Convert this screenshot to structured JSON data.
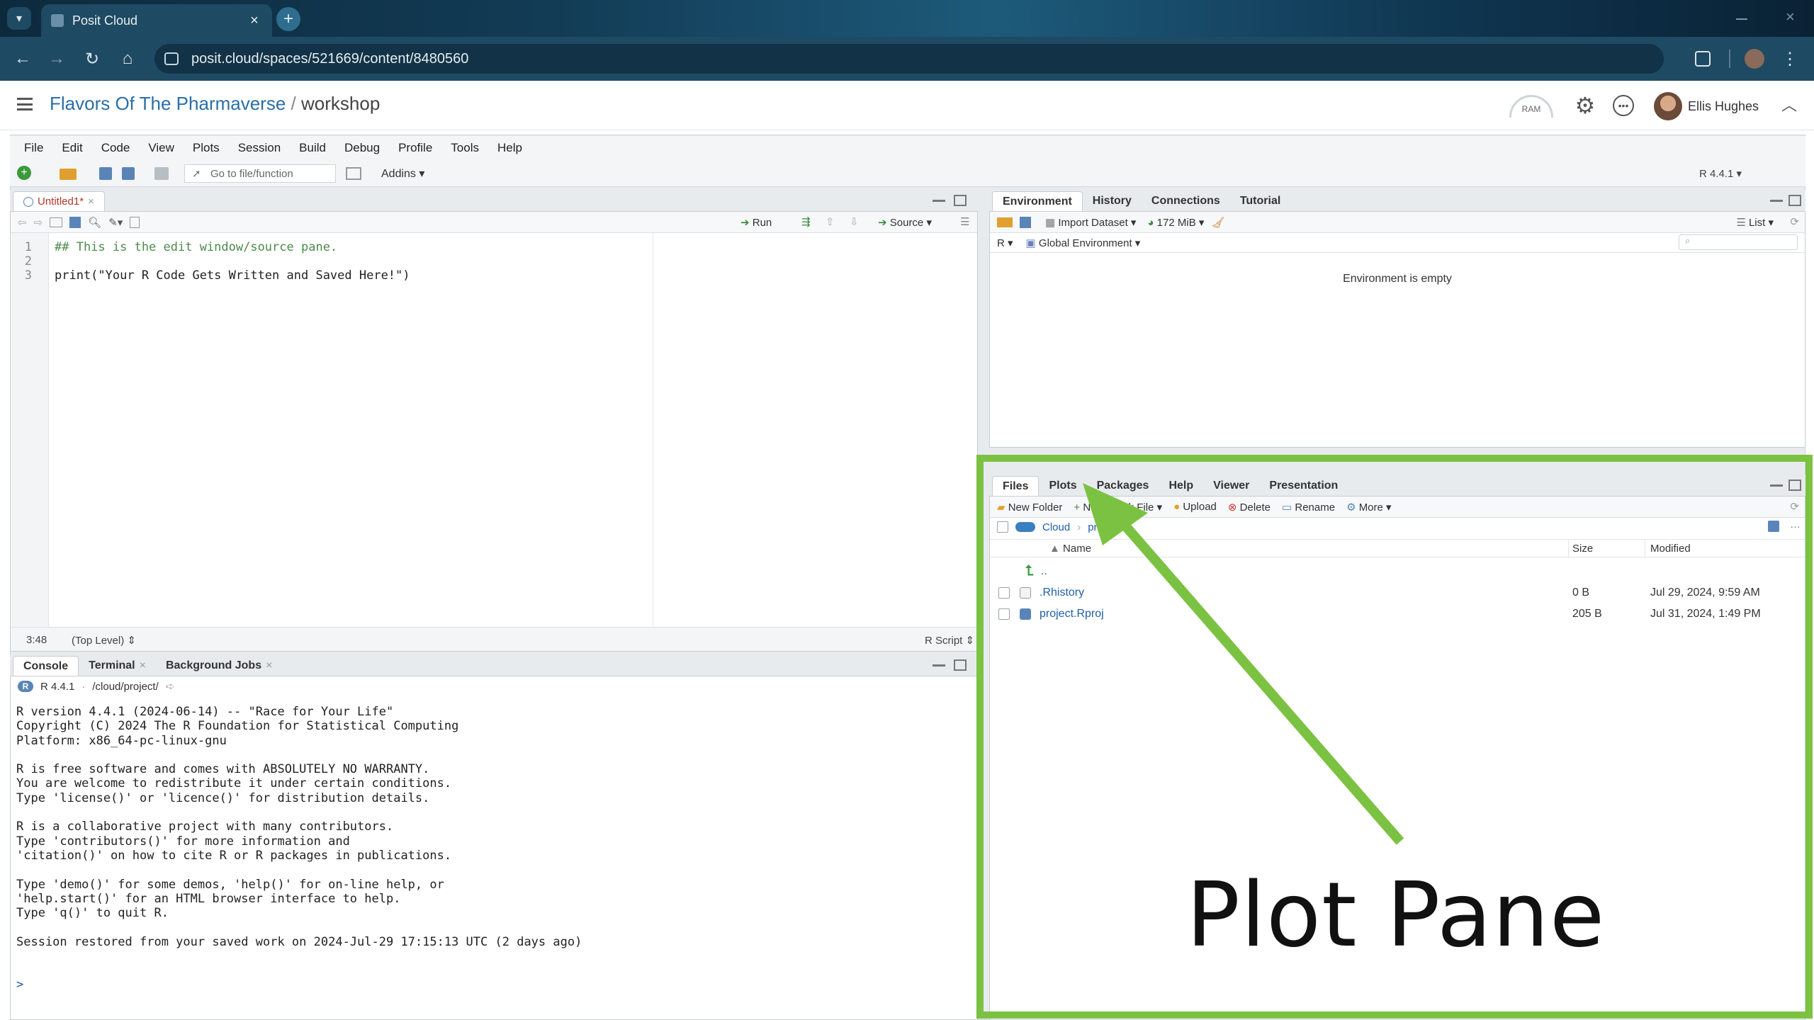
{
  "browser": {
    "tab_title": "Posit Cloud",
    "url": "posit.cloud/spaces/521669/content/8480560"
  },
  "header": {
    "space": "Flavors Of The Pharmaverse",
    "sep": "/",
    "project": "workshop",
    "ram_label": "RAM",
    "user": "Ellis Hughes"
  },
  "menu": [
    "File",
    "Edit",
    "Code",
    "View",
    "Plots",
    "Session",
    "Build",
    "Debug",
    "Profile",
    "Tools",
    "Help"
  ],
  "toolbar": {
    "goto_placeholder": "Go to file/function",
    "addins": "Addins",
    "r_version": "R 4.4.1"
  },
  "source": {
    "tab": "Untitled1*",
    "run": "Run",
    "source": "Source",
    "lines": [
      {
        "n": "1",
        "text": "## This is the edit window/source pane."
      },
      {
        "n": "2",
        "text": ""
      },
      {
        "n": "3",
        "text": "print(\"Your R Code Gets Written and Saved Here!\")"
      }
    ],
    "cursor_pos": "3:48",
    "scope": "(Top Level)",
    "filetype": "R Script"
  },
  "console": {
    "tabs": [
      "Console",
      "Terminal",
      "Background Jobs"
    ],
    "version_line": "R 4.4.1",
    "path": "/cloud/project/",
    "output": "R version 4.4.1 (2024-06-14) -- \"Race for Your Life\"\nCopyright (C) 2024 The R Foundation for Statistical Computing\nPlatform: x86_64-pc-linux-gnu\n\nR is free software and comes with ABSOLUTELY NO WARRANTY.\nYou are welcome to redistribute it under certain conditions.\nType 'license()' or 'licence()' for distribution details.\n\nR is a collaborative project with many contributors.\nType 'contributors()' for more information and\n'citation()' on how to cite R or R packages in publications.\n\nType 'demo()' for some demos, 'help()' for on-line help, or\n'help.start()' for an HTML browser interface to help.\nType 'q()' to quit R.\n\nSession restored from your saved work on 2024-Jul-29 17:15:13 UTC (2 days ago)",
    "prompt": ">"
  },
  "env": {
    "tabs": [
      "Environment",
      "History",
      "Connections",
      "Tutorial"
    ],
    "import": "Import Dataset",
    "mem": "172 MiB",
    "list": "List",
    "lang": "R",
    "scope": "Global Environment",
    "empty": "Environment is empty"
  },
  "files": {
    "tabs": [
      "Files",
      "Plots",
      "Packages",
      "Help",
      "Viewer",
      "Presentation"
    ],
    "actions": {
      "new_folder": "New Folder",
      "new_blank": "New Blank File",
      "upload": "Upload",
      "delete": "Delete",
      "rename": "Rename",
      "more": "More"
    },
    "path": [
      "Cloud",
      "project"
    ],
    "cols": {
      "name": "Name",
      "size": "Size",
      "modified": "Modified"
    },
    "up": "..",
    "rows": [
      {
        "name": ".Rhistory",
        "size": "0 B",
        "modified": "Jul 29, 2024, 9:59 AM"
      },
      {
        "name": "project.Rproj",
        "size": "205 B",
        "modified": "Jul 31, 2024, 1:49 PM"
      }
    ]
  },
  "annotation": {
    "label": "Plot Pane",
    "color": "#7cc242"
  }
}
